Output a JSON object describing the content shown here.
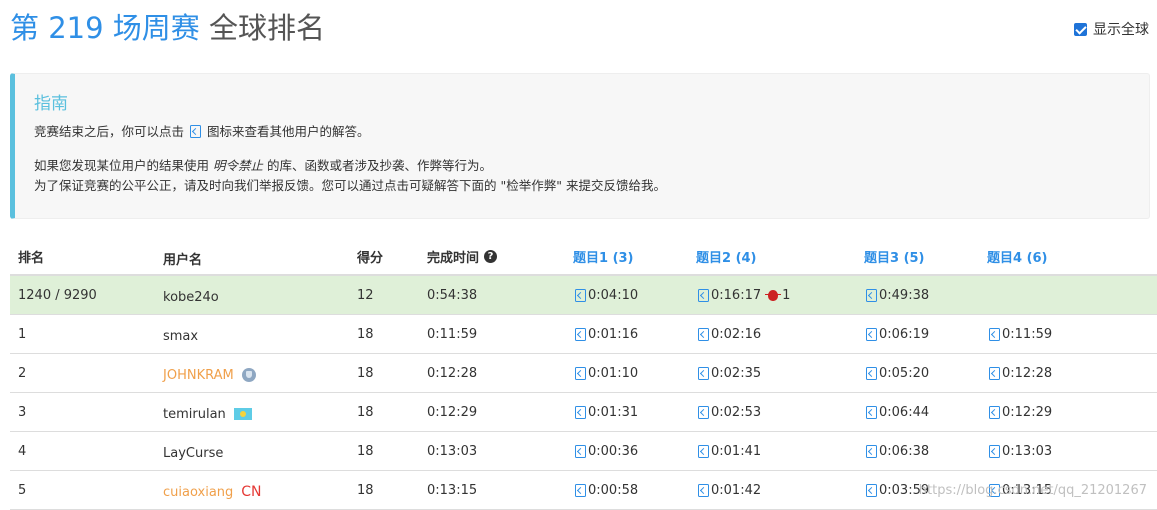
{
  "header": {
    "contest": "第 219 场周赛",
    "subtitle": "全球排名",
    "show_global_label": "显示全球",
    "show_global_checked": true
  },
  "guide": {
    "title": "指南",
    "line1_before": "竞赛结束之后，你可以点击",
    "line1_after": "图标来查看其他用户的解答。",
    "line2_before": "如果您发现某位用户的结果使用",
    "line2_emphasis": "明令禁止",
    "line2_after": "的库、函数或者涉及抄袭、作弊等行为。",
    "line3": "为了保证竞赛的公平公正，请及时向我们举报反馈。您可以通过点击可疑解答下面的 \"检举作弊\" 来提交反馈给我。"
  },
  "table": {
    "columns": {
      "rank": "排名",
      "user": "用户名",
      "score": "得分",
      "time": "完成时间",
      "q1": "题目1 (3)",
      "q2": "题目2 (4)",
      "q3": "题目3 (5)",
      "q4": "题目4 (6)"
    },
    "mine": {
      "rank": "1240 / 9290",
      "user": "kobe24o",
      "score": "12",
      "time": "0:54:38",
      "q1": "0:04:10",
      "q2": "0:16:17",
      "q2_penalty": "1",
      "q3": "0:49:38"
    },
    "rows": [
      {
        "rank": "1",
        "user": "smax",
        "score": "18",
        "time": "0:11:59",
        "q1": "0:01:16",
        "q2": "0:02:16",
        "q3": "0:06:19",
        "q4": "0:11:59"
      },
      {
        "rank": "2",
        "user": "JOHNKRAM",
        "score": "18",
        "time": "0:12:28",
        "q1": "0:01:10",
        "q2": "0:02:35",
        "q3": "0:05:20",
        "q4": "0:12:28"
      },
      {
        "rank": "3",
        "user": "temirulan",
        "score": "18",
        "time": "0:12:29",
        "q1": "0:01:31",
        "q2": "0:02:53",
        "q3": "0:06:44",
        "q4": "0:12:29"
      },
      {
        "rank": "4",
        "user": "LayCurse",
        "score": "18",
        "time": "0:13:03",
        "q1": "0:00:36",
        "q2": "0:01:41",
        "q3": "0:06:38",
        "q4": "0:13:03"
      },
      {
        "rank": "5",
        "user": "cuiaoxiang",
        "user_region": "CN",
        "score": "18",
        "time": "0:13:15",
        "q1": "0:00:58",
        "q2": "0:01:42",
        "q3": "0:03:59",
        "q4": "0:13:15"
      }
    ]
  },
  "watermark": "https://blog.csdn.net/qq_21201267",
  "colors": {
    "accent": "#2f8fe6",
    "guide_border": "#5bc0de",
    "mine_row": "#dff0d8",
    "badge_orange": "#f0a04b",
    "region_red": "#e53935"
  }
}
